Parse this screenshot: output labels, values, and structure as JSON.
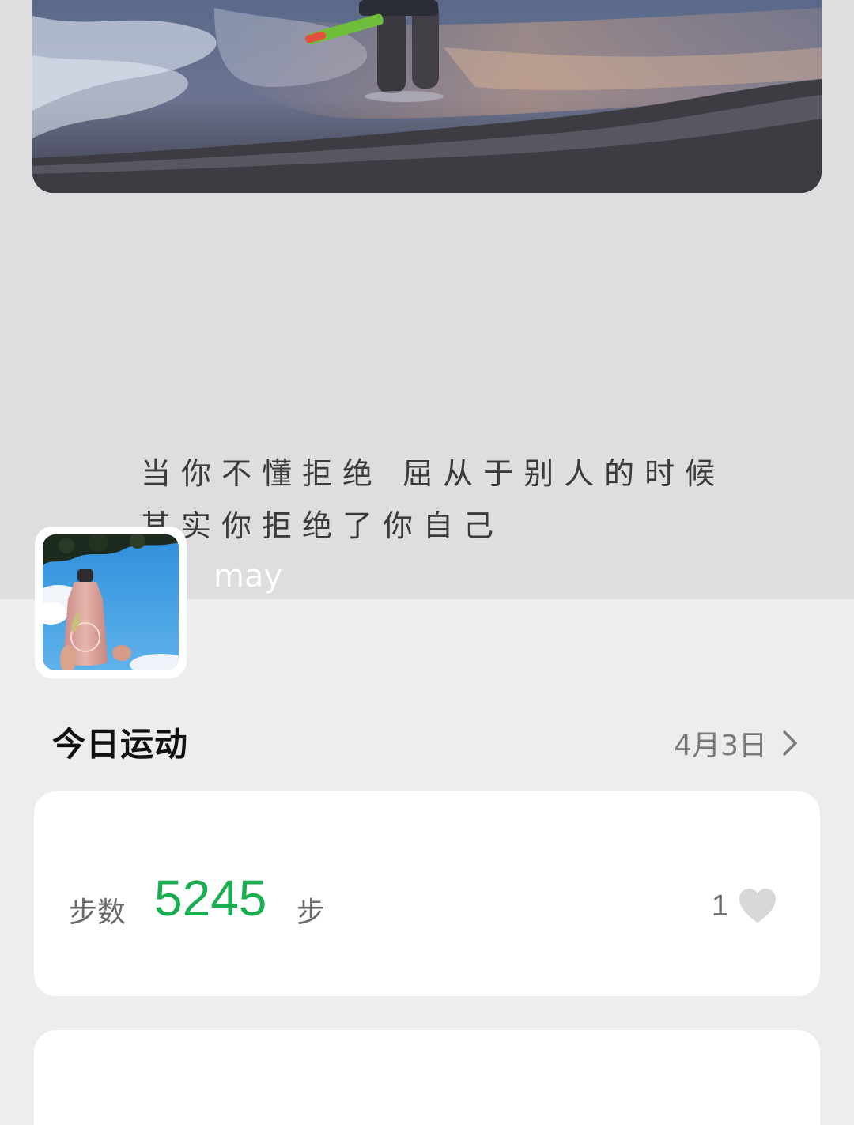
{
  "cover": {
    "quote_line1": "当你不懂拒绝 屈从于别人的时候",
    "quote_line2": "其实你拒绝了你自己",
    "nickname": "may"
  },
  "today": {
    "title": "今日运动",
    "date": "4月3日"
  },
  "steps": {
    "label": "步数",
    "value": "5245",
    "unit": "步",
    "likes": "1"
  },
  "colors": {
    "step_value": "#1aad52",
    "page_bg": "#ededed",
    "cover_bg": "#dedee0",
    "heart": "#d8d8d8"
  },
  "icons": {
    "date_arrow": "chevron-right-icon",
    "like": "heart-icon"
  }
}
